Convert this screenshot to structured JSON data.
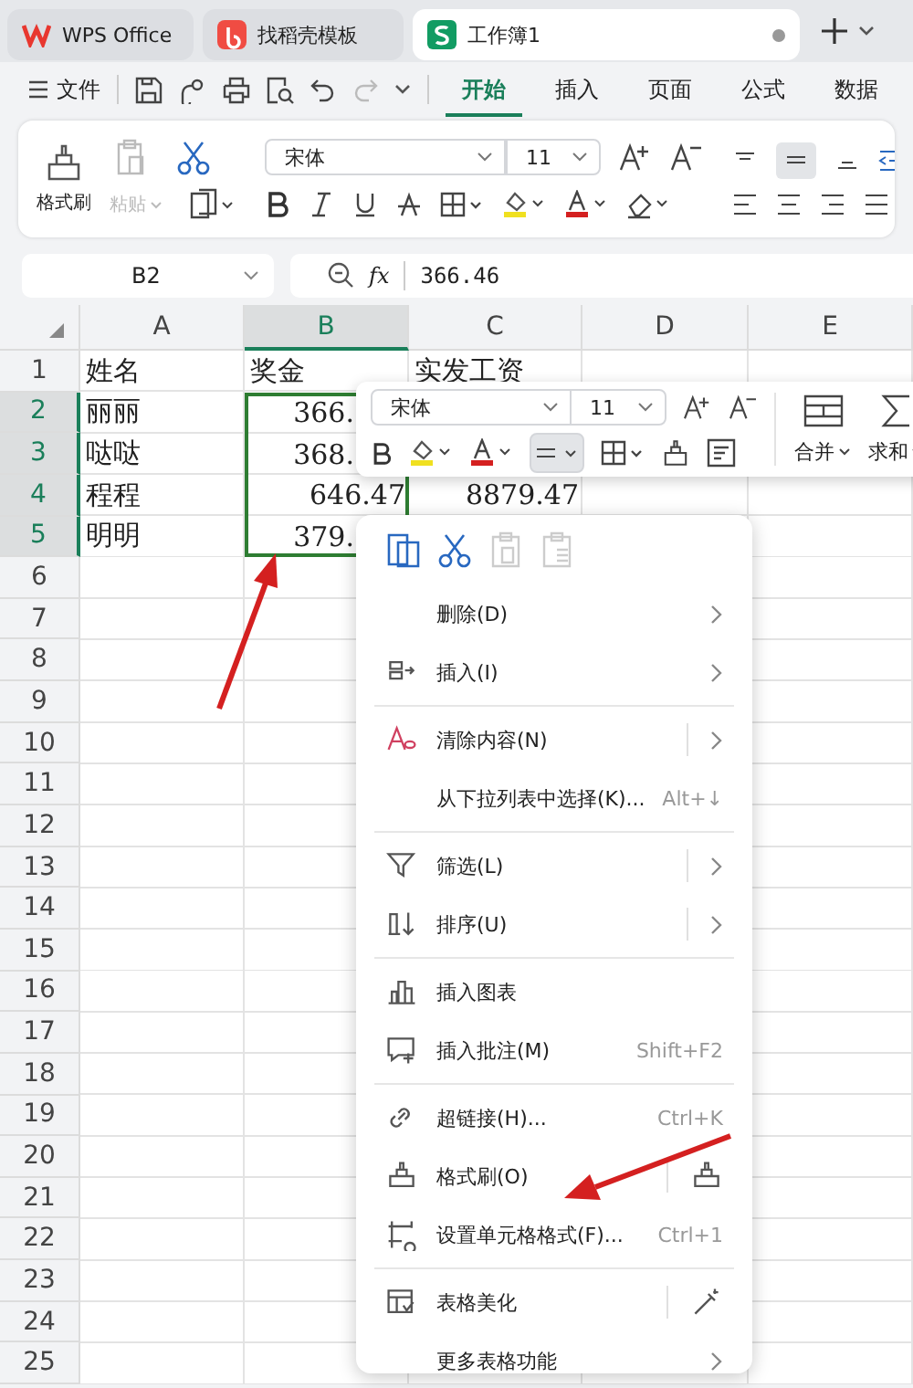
{
  "tabs": [
    {
      "label": "WPS Office",
      "kind": "wps",
      "selected": false
    },
    {
      "label": "找稻壳模板",
      "kind": "docer",
      "selected": false
    },
    {
      "label": "工作簿1",
      "kind": "sheet",
      "selected": true
    }
  ],
  "menu_bar": {
    "file": "文件",
    "tabs": [
      {
        "label": "开始",
        "selected": true
      },
      {
        "label": "插入",
        "selected": false
      },
      {
        "label": "页面",
        "selected": false
      },
      {
        "label": "公式",
        "selected": false
      },
      {
        "label": "数据",
        "selected": false
      }
    ]
  },
  "ribbon": {
    "format_painter": "格式刷",
    "paste": {
      "label": "粘贴",
      "disabled": true
    },
    "font": "宋体",
    "size": "11"
  },
  "formula_bar": {
    "cell_ref": "B2",
    "fx": "fx",
    "value": "366.46"
  },
  "sheet": {
    "columns": [
      {
        "label": "A",
        "selected": false
      },
      {
        "label": "B",
        "selected": true
      },
      {
        "label": "C",
        "selected": false
      },
      {
        "label": "D",
        "selected": false
      },
      {
        "label": "E",
        "selected": false
      }
    ],
    "rows": [
      {
        "number": "1",
        "selected": false,
        "cells": {
          "A": {
            "text": "姓名",
            "kind": "text"
          },
          "B": {
            "text": "奖金",
            "kind": "text"
          },
          "C": {
            "text": "实发工资",
            "kind": "text"
          }
        }
      },
      {
        "number": "2",
        "selected": true,
        "cells": {
          "A": {
            "text": "丽丽",
            "kind": "text"
          },
          "B": {
            "text": "366.",
            "kind": "number",
            "cut": true
          }
        }
      },
      {
        "number": "3",
        "selected": true,
        "cells": {
          "A": {
            "text": "哒哒",
            "kind": "text"
          },
          "B": {
            "text": "368.",
            "kind": "number",
            "cut": true
          }
        }
      },
      {
        "number": "4",
        "selected": true,
        "cells": {
          "A": {
            "text": "程程",
            "kind": "text"
          },
          "B": {
            "text": "646.47",
            "kind": "number"
          },
          "C": {
            "text": "8879.47",
            "kind": "number"
          }
        }
      },
      {
        "number": "5",
        "selected": true,
        "cells": {
          "A": {
            "text": "明明",
            "kind": "text"
          },
          "B": {
            "text": "379.",
            "kind": "number",
            "cut": true
          }
        }
      },
      {
        "number": "6",
        "selected": false
      },
      {
        "number": "7",
        "selected": false
      },
      {
        "number": "8",
        "selected": false
      },
      {
        "number": "9",
        "selected": false
      },
      {
        "number": "10",
        "selected": false
      },
      {
        "number": "11",
        "selected": false
      },
      {
        "number": "12",
        "selected": false
      },
      {
        "number": "13",
        "selected": false
      },
      {
        "number": "14",
        "selected": false
      },
      {
        "number": "15",
        "selected": false
      },
      {
        "number": "16",
        "selected": false
      },
      {
        "number": "17",
        "selected": false
      },
      {
        "number": "18",
        "selected": false
      },
      {
        "number": "19",
        "selected": false
      },
      {
        "number": "20",
        "selected": false
      },
      {
        "number": "21",
        "selected": false
      },
      {
        "number": "22",
        "selected": false
      },
      {
        "number": "23",
        "selected": false
      },
      {
        "number": "24",
        "selected": false
      },
      {
        "number": "25",
        "selected": false
      }
    ]
  },
  "mini_toolbar": {
    "font": "宋体",
    "size": "11",
    "align_active": true,
    "merge": "合并",
    "sum": "求和"
  },
  "context_menu": {
    "items": [
      {
        "label": "删除(D)",
        "submenu": true,
        "split": false,
        "separator_before": false
      },
      {
        "label": "插入(I)",
        "submenu": true,
        "split": false,
        "separator_before": false
      },
      {
        "label": "清除内容(N)",
        "submenu": true,
        "split": true,
        "separator_before": true
      },
      {
        "label": "从下拉列表中选择(K)...",
        "shortcut": "Alt+↓",
        "submenu": false,
        "split": false,
        "separator_before": false
      },
      {
        "label": "筛选(L)",
        "submenu": true,
        "split": true,
        "separator_before": true
      },
      {
        "label": "排序(U)",
        "submenu": true,
        "split": true,
        "separator_before": false
      },
      {
        "label": "插入图表",
        "submenu": false,
        "split": false,
        "separator_before": true
      },
      {
        "label": "插入批注(M)",
        "shortcut": "Shift+F2",
        "submenu": false,
        "split": false,
        "separator_before": false
      },
      {
        "label": "超链接(H)...",
        "shortcut": "Ctrl+K",
        "submenu": false,
        "split": false,
        "separator_before": true
      },
      {
        "label": "格式刷(O)",
        "submenu": false,
        "split": true,
        "separator_before": false
      },
      {
        "label": "设置单元格格式(F)...",
        "shortcut": "Ctrl+1",
        "submenu": false,
        "split": false,
        "separator_before": false
      },
      {
        "label": "表格美化",
        "submenu": false,
        "split": true,
        "separator_before": true
      },
      {
        "label": "更多表格功能",
        "submenu": true,
        "split": false,
        "separator_before": false
      }
    ]
  }
}
